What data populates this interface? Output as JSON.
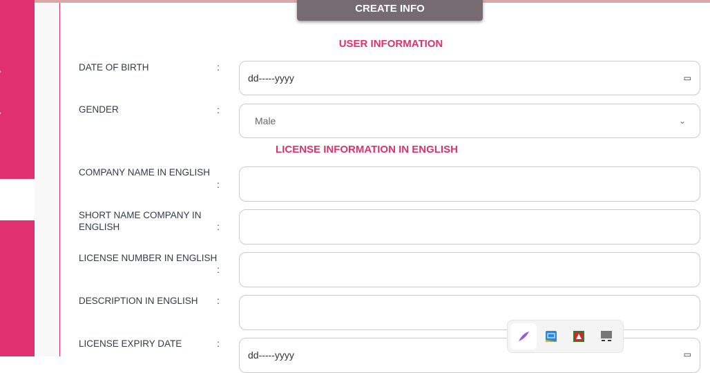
{
  "header": {
    "create_label": "CREATE INFO"
  },
  "sections": {
    "user": "USER INFORMATION",
    "license": "LICENSE INFORMATION IN ENGLISH"
  },
  "fields": [
    {
      "label": "DATE OF BIRTH",
      "value": "dd-----yyyy"
    },
    {
      "label": "GENDER",
      "value": "Male"
    },
    {
      "label": "COMPANY NAME IN ENGLISH",
      "value": ""
    },
    {
      "label": "SHORT NAME COMPANY IN ENGLISH",
      "value": ""
    },
    {
      "label": "LICENSE NUMBER IN ENGLISH",
      "value": ""
    },
    {
      "label": "DESCRIPTION IN ENGLISH",
      "value": ""
    },
    {
      "label": "LICENSE EXPIRY DATE",
      "value": "dd-----yyyy"
    }
  ],
  "colon": ":",
  "colors": {
    "accent": "#e0306e",
    "button": "#766b70"
  }
}
